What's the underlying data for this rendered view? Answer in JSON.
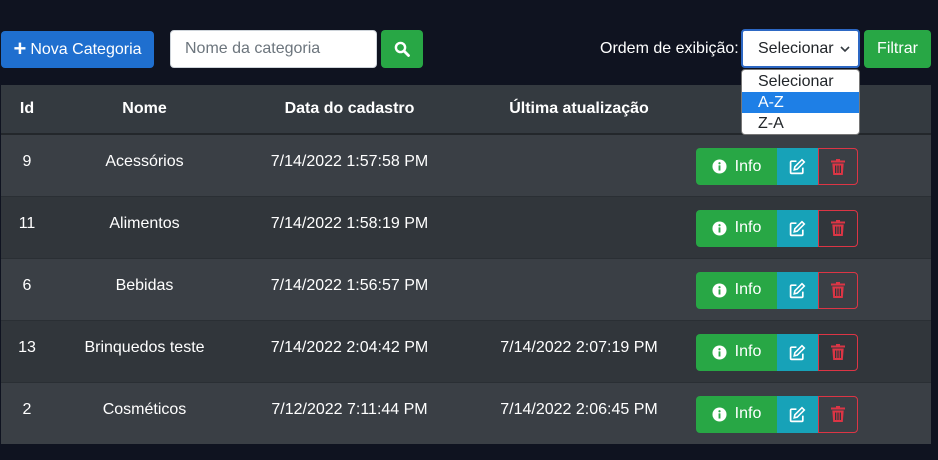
{
  "toolbar": {
    "new_category_label": "Nova Categoria",
    "search_placeholder": "Nome da categoria",
    "search_value": "",
    "order_label": "Ordem de exibição:",
    "order_selected": "Selecionar",
    "filter_label": "Filtrar"
  },
  "order_options": [
    {
      "label": "Selecionar",
      "highlighted": false
    },
    {
      "label": "A-Z",
      "highlighted": true
    },
    {
      "label": "Z-A",
      "highlighted": false
    }
  ],
  "table": {
    "headers": [
      "Id",
      "Nome",
      "Data do cadastro",
      "Última atualização",
      ""
    ],
    "rows": [
      {
        "id": "9",
        "name": "Acessórios",
        "created": "7/14/2022 1:57:58 PM",
        "updated": ""
      },
      {
        "id": "11",
        "name": "Alimentos",
        "created": "7/14/2022 1:58:19 PM",
        "updated": ""
      },
      {
        "id": "6",
        "name": "Bebidas",
        "created": "7/14/2022 1:56:57 PM",
        "updated": ""
      },
      {
        "id": "13",
        "name": "Brinquedos teste",
        "created": "7/14/2022 2:04:42 PM",
        "updated": "7/14/2022 2:07:19 PM"
      },
      {
        "id": "2",
        "name": "Cosméticos",
        "created": "7/12/2022 7:11:44 PM",
        "updated": "7/14/2022 2:06:45 PM"
      }
    ],
    "info_label": "Info"
  },
  "colors": {
    "background": "#0f1320",
    "primary": "#1f6fcf",
    "success": "#28a745",
    "info": "#17a2b8",
    "danger": "#dc3545"
  },
  "icons": [
    "plus-icon",
    "search-icon",
    "chevron-down-icon",
    "info-icon",
    "edit-icon",
    "trash-icon"
  ]
}
